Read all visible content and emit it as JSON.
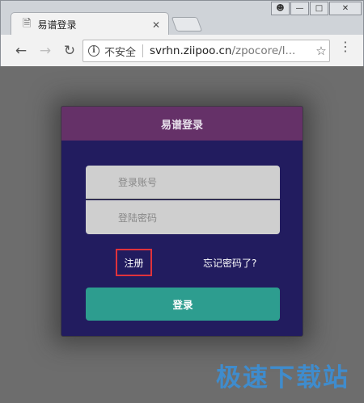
{
  "browser": {
    "tab": {
      "title": "易谱登录"
    },
    "address_bar": {
      "security_label": "不安全",
      "host": "svrhn.ziipoo.cn",
      "path": "/zpocore/l..."
    }
  },
  "page": {
    "card": {
      "title": "易谱登录",
      "username_placeholder": "登录账号",
      "password_placeholder": "登陆密码",
      "register_label": "注册",
      "forgot_label": "忘记密码了?",
      "login_label": "登录"
    },
    "watermark": "极速下载站"
  },
  "colors": {
    "card_header": "#653168",
    "card_body": "#221c5f",
    "login_button": "#2d9d8f",
    "highlight_box": "#e0323b",
    "watermark": "#3c8fd6"
  }
}
